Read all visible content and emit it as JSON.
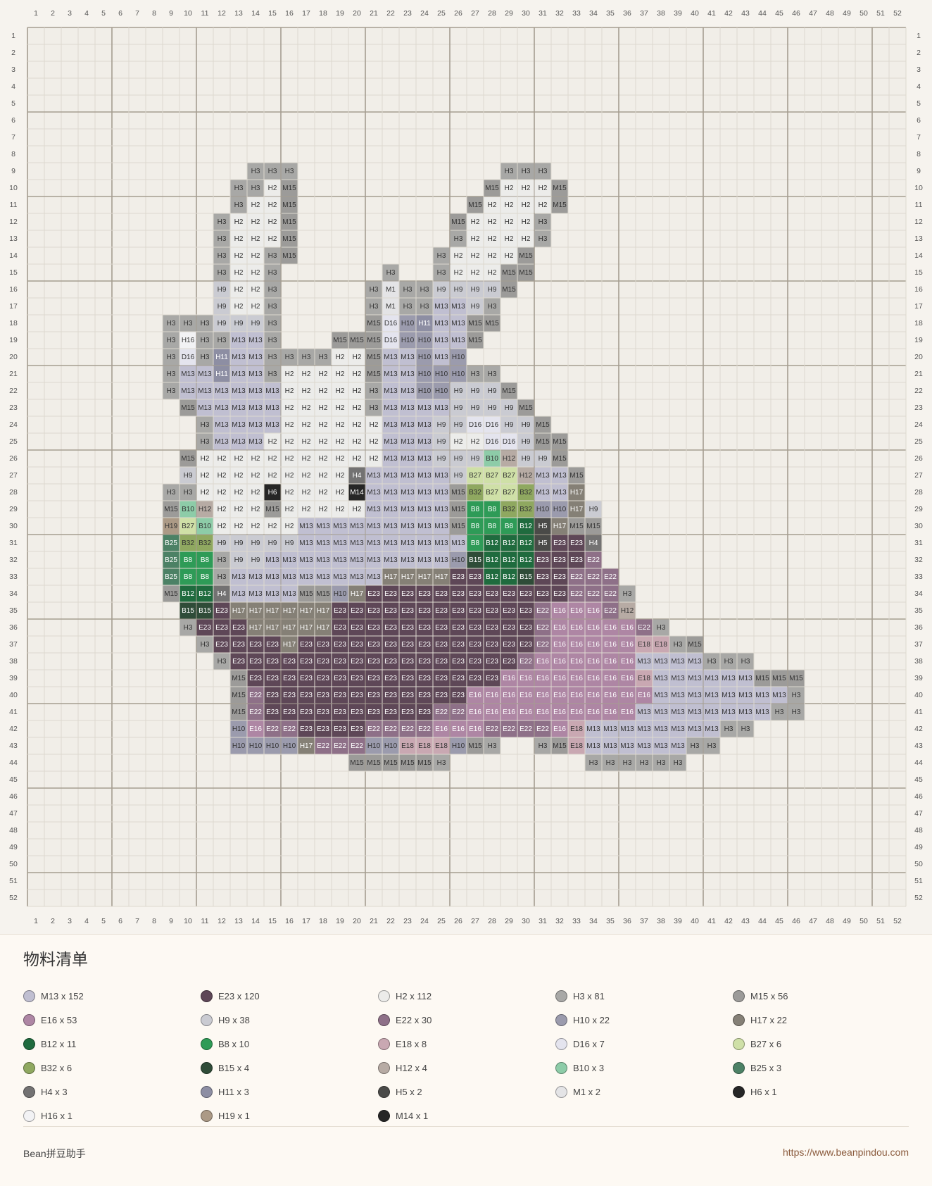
{
  "axis": {
    "count": 52
  },
  "palette": {
    "H2": "#ececea",
    "H3": "#a8a8a6",
    "M15": "#9c9b99",
    "H9": "#cacbd2",
    "M1": "#e4e4e6",
    "M13": "#c0bfd1",
    "D16": "#e4e4ee",
    "H10": "#9b9bad",
    "H11": "#8d8ea3",
    "H16": "#f2f2f4",
    "H12": "#b7aba4",
    "B10": "#8dcca8",
    "B27": "#cfe0a7",
    "B32": "#8fa860",
    "H4": "#737272",
    "H6": "#262626",
    "M14": "#262626",
    "B8": "#2e9b57",
    "B12": "#1f6b3e",
    "H5": "#4a4a48",
    "H17": "#858076",
    "H19": "#ac9a86",
    "B25": "#4c8165",
    "B15": "#2f4c38",
    "E23": "#5e4757",
    "E22": "#8e7088",
    "E16": "#ae86a4",
    "E18": "#c9a8b2"
  },
  "grid_rows": [
    {
      "row": 9,
      "start": 14,
      "cells": [
        "H3",
        "H3",
        "H3"
      ]
    },
    {
      "row": 9,
      "start": 29,
      "cells": [
        "H3",
        "H3",
        "H3"
      ]
    },
    {
      "row": 10,
      "start": 13,
      "cells": [
        "H3",
        "H3",
        "H2",
        "M15"
      ]
    },
    {
      "row": 10,
      "start": 28,
      "cells": [
        "M15",
        "H2",
        "H2",
        "H2",
        "M15"
      ]
    },
    {
      "row": 11,
      "start": 13,
      "cells": [
        "H3",
        "H2",
        "H2",
        "M15"
      ]
    },
    {
      "row": 11,
      "start": 27,
      "cells": [
        "M15",
        "H2",
        "H2",
        "H2",
        "H2",
        "M15"
      ]
    },
    {
      "row": 12,
      "start": 12,
      "cells": [
        "H3",
        "H2",
        "H2",
        "H2",
        "M15"
      ]
    },
    {
      "row": 12,
      "start": 26,
      "cells": [
        "M15",
        "H2",
        "H2",
        "H2",
        "H2",
        "H3"
      ]
    },
    {
      "row": 13,
      "start": 12,
      "cells": [
        "H3",
        "H2",
        "H2",
        "H2",
        "M15"
      ]
    },
    {
      "row": 13,
      "start": 26,
      "cells": [
        "H3",
        "H2",
        "H2",
        "H2",
        "H2",
        "H3"
      ]
    },
    {
      "row": 14,
      "start": 12,
      "cells": [
        "H3",
        "H2",
        "H2",
        "H3",
        "M15"
      ]
    },
    {
      "row": 14,
      "start": 25,
      "cells": [
        "H3",
        "H2",
        "H2",
        "H2",
        "H2",
        "M15"
      ]
    },
    {
      "row": 15,
      "start": 12,
      "cells": [
        "H3",
        "H2",
        "H2",
        "H3"
      ]
    },
    {
      "row": 15,
      "start": 22,
      "cells": [
        "H3"
      ]
    },
    {
      "row": 15,
      "start": 25,
      "cells": [
        "H3",
        "H2",
        "H2",
        "H2",
        "M15",
        "M15"
      ]
    },
    {
      "row": 16,
      "start": 12,
      "cells": [
        "H9",
        "H2",
        "H2",
        "H3"
      ]
    },
    {
      "row": 16,
      "start": 21,
      "cells": [
        "H3",
        "M1",
        "H3",
        "H3",
        "H9",
        "H9",
        "H9",
        "H9",
        "M15"
      ]
    },
    {
      "row": 17,
      "start": 12,
      "cells": [
        "H9",
        "H2",
        "H2",
        "H3"
      ]
    },
    {
      "row": 17,
      "start": 21,
      "cells": [
        "H3",
        "M1",
        "H3",
        "H3",
        "M13",
        "M13",
        "H9",
        "H3"
      ]
    },
    {
      "row": 18,
      "start": 9,
      "cells": [
        "H3",
        "H3",
        "H3",
        "H9",
        "H9",
        "H9",
        "H3"
      ]
    },
    {
      "row": 18,
      "start": 21,
      "cells": [
        "M15",
        "D16",
        "H10",
        "H11",
        "M13",
        "M13",
        "M15",
        "M15"
      ]
    },
    {
      "row": 19,
      "start": 9,
      "cells": [
        "H3",
        "H16",
        "H3",
        "H3",
        "M13",
        "M13",
        "H3"
      ]
    },
    {
      "row": 19,
      "start": 19,
      "cells": [
        "M15",
        "M15",
        "M15",
        "D16",
        "H10",
        "H10",
        "M13",
        "M13",
        "M15"
      ]
    },
    {
      "row": 20,
      "start": 9,
      "cells": [
        "H3",
        "D16",
        "H3",
        "H11",
        "M13",
        "M13",
        "H3",
        "H3",
        "H3",
        "H3",
        "H2",
        "H2",
        "M15",
        "M13",
        "M13",
        "H10",
        "M13",
        "H10"
      ]
    },
    {
      "row": 21,
      "start": 9,
      "cells": [
        "H3",
        "M13",
        "M13",
        "H11",
        "M13",
        "M13",
        "H3",
        "H2",
        "H2",
        "H2",
        "H2",
        "H2",
        "M15",
        "M13",
        "M13",
        "H10",
        "H10",
        "H10",
        "H3",
        "H3"
      ]
    },
    {
      "row": 22,
      "start": 9,
      "cells": [
        "H3",
        "M13",
        "M13",
        "M13",
        "M13",
        "M13",
        "M13",
        "H2",
        "H2",
        "H2",
        "H2",
        "H2",
        "H3",
        "M13",
        "M13",
        "H10",
        "H10",
        "H9",
        "H9",
        "H9",
        "M15"
      ]
    },
    {
      "row": 23,
      "start": 10,
      "cells": [
        "M15",
        "M13",
        "M13",
        "M13",
        "M13",
        "M13",
        "H2",
        "H2",
        "H2",
        "H2",
        "H2",
        "H3",
        "M13",
        "M13",
        "M13",
        "M13",
        "H9",
        "H9",
        "H9",
        "H9",
        "M15"
      ]
    },
    {
      "row": 24,
      "start": 11,
      "cells": [
        "H3",
        "M13",
        "M13",
        "M13",
        "M13",
        "H2",
        "H2",
        "H2",
        "H2",
        "H2",
        "H2",
        "M13",
        "M13",
        "M13",
        "H9",
        "H9",
        "D16",
        "D16",
        "H9",
        "H9",
        "M15"
      ]
    },
    {
      "row": 25,
      "start": 11,
      "cells": [
        "H3",
        "M13",
        "M13",
        "M13",
        "H2",
        "H2",
        "H2",
        "H2",
        "H2",
        "H2",
        "H2",
        "M13",
        "M13",
        "M13",
        "H9",
        "H2",
        "H2",
        "D16",
        "D16",
        "H9",
        "M15",
        "M15"
      ]
    },
    {
      "row": 26,
      "start": 10,
      "cells": [
        "M15",
        "H2",
        "H2",
        "H2",
        "H2",
        "H2",
        "H2",
        "H2",
        "H2",
        "H2",
        "H2",
        "H2",
        "M13",
        "M13",
        "M13",
        "H9",
        "H9",
        "H9",
        "B10",
        "H12",
        "H9",
        "H9",
        "M15"
      ]
    },
    {
      "row": 27,
      "start": 10,
      "cells": [
        "H9",
        "H2",
        "H2",
        "H2",
        "H2",
        "H2",
        "H2",
        "H2",
        "H2",
        "H2",
        "H4",
        "M13",
        "M13",
        "M13",
        "M13",
        "M13",
        "H9",
        "B27",
        "B27",
        "B27",
        "H12",
        "M13",
        "M13",
        "M15"
      ]
    },
    {
      "row": 28,
      "start": 9,
      "cells": [
        "H3",
        "H3",
        "H2",
        "H2",
        "H2",
        "H2",
        "H6",
        "H2",
        "H2",
        "H2",
        "H2",
        "M14",
        "M13",
        "M13",
        "M13",
        "M13",
        "M13",
        "M15",
        "B32",
        "B27",
        "B27",
        "B32",
        "M13",
        "M13",
        "H17"
      ]
    },
    {
      "row": 29,
      "start": 9,
      "cells": [
        "M15",
        "B10",
        "H12",
        "H2",
        "H2",
        "H2",
        "M15",
        "H2",
        "H2",
        "H2",
        "H2",
        "H2",
        "M13",
        "M13",
        "M13",
        "M13",
        "M13",
        "M15",
        "B8",
        "B8",
        "B32",
        "B32",
        "H10",
        "H10",
        "H17",
        "H9"
      ]
    },
    {
      "row": 30,
      "start": 9,
      "cells": [
        "H19",
        "B27",
        "B10",
        "H2",
        "H2",
        "H2",
        "H2",
        "H2",
        "M13",
        "M13",
        "M13",
        "M13",
        "M13",
        "M13",
        "M13",
        "M13",
        "M13",
        "M15",
        "B8",
        "B8",
        "B8",
        "B12",
        "H5",
        "H17",
        "M15",
        "M15"
      ]
    },
    {
      "row": 31,
      "start": 9,
      "cells": [
        "B25",
        "B32",
        "B32",
        "H9",
        "H9",
        "H9",
        "H9",
        "H9",
        "M13",
        "M13",
        "M13",
        "M13",
        "M13",
        "M13",
        "M13",
        "M13",
        "M13",
        "M13",
        "B8",
        "B12",
        "B12",
        "B12",
        "H5",
        "E23",
        "E23",
        "H4"
      ]
    },
    {
      "row": 32,
      "start": 9,
      "cells": [
        "B25",
        "B8",
        "B8",
        "H3",
        "H9",
        "H9",
        "M13",
        "M13",
        "M13",
        "M13",
        "M13",
        "M13",
        "M13",
        "M13",
        "M13",
        "M13",
        "M13",
        "H10",
        "B15",
        "B12",
        "B12",
        "B12",
        "E23",
        "E23",
        "E23",
        "E22"
      ]
    },
    {
      "row": 33,
      "start": 9,
      "cells": [
        "B25",
        "B8",
        "B8",
        "H3",
        "M13",
        "M13",
        "M13",
        "M13",
        "M13",
        "M13",
        "M13",
        "M13",
        "M13",
        "H17",
        "H17",
        "H17",
        "H17",
        "E23",
        "E23",
        "B12",
        "B12",
        "B15",
        "E23",
        "E23",
        "E22",
        "E22",
        "E22"
      ]
    },
    {
      "row": 34,
      "start": 9,
      "cells": [
        "M15",
        "B12",
        "B12",
        "H4",
        "M13",
        "M13",
        "M13",
        "M13",
        "M15",
        "M15",
        "H10",
        "H17",
        "E23",
        "E23",
        "E23",
        "E23",
        "E23",
        "E23",
        "E23",
        "E23",
        "E23",
        "E23",
        "E23",
        "E23",
        "E22",
        "E22",
        "E22",
        "H3"
      ]
    },
    {
      "row": 35,
      "start": 10,
      "cells": [
        "B15",
        "B15",
        "E23",
        "H17",
        "H17",
        "H17",
        "H17",
        "H17",
        "H17",
        "E23",
        "E23",
        "E23",
        "E23",
        "E23",
        "E23",
        "E23",
        "E23",
        "E23",
        "E23",
        "E23",
        "E23",
        "E22",
        "E16",
        "E16",
        "E16",
        "E22",
        "H12"
      ]
    },
    {
      "row": 36,
      "start": 10,
      "cells": [
        "H3",
        "E23",
        "E23",
        "E23",
        "H17",
        "H17",
        "H17",
        "H17",
        "H17",
        "E23",
        "E23",
        "E23",
        "E23",
        "E23",
        "E23",
        "E23",
        "E23",
        "E23",
        "E23",
        "E23",
        "E23",
        "E22",
        "E16",
        "E16",
        "E16",
        "E16",
        "E16",
        "E22",
        "H3"
      ]
    },
    {
      "row": 37,
      "start": 11,
      "cells": [
        "H3",
        "E23",
        "E23",
        "E23",
        "E23",
        "H17",
        "E23",
        "E23",
        "E23",
        "E23",
        "E23",
        "E23",
        "E23",
        "E23",
        "E23",
        "E23",
        "E23",
        "E23",
        "E23",
        "E23",
        "E22",
        "E16",
        "E16",
        "E16",
        "E16",
        "E16",
        "E18",
        "E18",
        "H3",
        "M15"
      ]
    },
    {
      "row": 38,
      "start": 12,
      "cells": [
        "H3",
        "E23",
        "E23",
        "E23",
        "E23",
        "E23",
        "E23",
        "E23",
        "E23",
        "E23",
        "E23",
        "E23",
        "E23",
        "E23",
        "E23",
        "E23",
        "E23",
        "E23",
        "E22",
        "E16",
        "E16",
        "E16",
        "E16",
        "E16",
        "E16",
        "M13",
        "M13",
        "M13",
        "M13",
        "H3",
        "H3",
        "H3"
      ]
    },
    {
      "row": 39,
      "start": 13,
      "cells": [
        "M15",
        "E23",
        "E23",
        "E23",
        "E23",
        "E23",
        "E23",
        "E23",
        "E23",
        "E23",
        "E23",
        "E23",
        "E23",
        "E23",
        "E23",
        "E23",
        "E16",
        "E16",
        "E16",
        "E16",
        "E16",
        "E16",
        "E16",
        "E16",
        "E18",
        "M13",
        "M13",
        "M13",
        "M13",
        "M13",
        "M13",
        "M15",
        "M15",
        "M15"
      ]
    },
    {
      "row": 40,
      "start": 13,
      "cells": [
        "M15",
        "E22",
        "E23",
        "E23",
        "E23",
        "E23",
        "E23",
        "E23",
        "E23",
        "E23",
        "E23",
        "E23",
        "E23",
        "E23",
        "E16",
        "E16",
        "E16",
        "E16",
        "E16",
        "E16",
        "E16",
        "E16",
        "E16",
        "E16",
        "E16",
        "M13",
        "M13",
        "M13",
        "M13",
        "M13",
        "M13",
        "M13",
        "M13",
        "H3"
      ]
    },
    {
      "row": 41,
      "start": 13,
      "cells": [
        "M15",
        "E22",
        "E23",
        "E23",
        "E23",
        "E23",
        "E23",
        "E23",
        "E23",
        "E23",
        "E23",
        "E23",
        "E22",
        "E22",
        "E16",
        "E16",
        "E16",
        "E16",
        "E16",
        "E16",
        "E16",
        "E16",
        "E16",
        "E16",
        "M13",
        "M13",
        "M13",
        "M13",
        "M13",
        "M13",
        "M13",
        "M13",
        "H3",
        "H3"
      ]
    },
    {
      "row": 42,
      "start": 13,
      "cells": [
        "H10",
        "E16",
        "E22",
        "E22",
        "E23",
        "E23",
        "E23",
        "E23",
        "E22",
        "E22",
        "E22",
        "E22",
        "E16",
        "E16",
        "E16",
        "E22",
        "E22",
        "E22",
        "E22",
        "E16",
        "E18",
        "M13",
        "M13",
        "M13",
        "M13",
        "M13",
        "M13",
        "M13",
        "M13",
        "H3",
        "H3"
      ]
    },
    {
      "row": 43,
      "start": 13,
      "cells": [
        "H10",
        "H10",
        "H10",
        "H10",
        "H17",
        "E22",
        "E22",
        "E22",
        "H10",
        "H10",
        "E18",
        "E18",
        "E18",
        "H10",
        "M15",
        "H3"
      ]
    },
    {
      "row": 43,
      "start": 31,
      "cells": [
        "H3",
        "M15",
        "E18",
        "M13",
        "M13",
        "M13",
        "M13",
        "M13",
        "M13",
        "H3",
        "H3"
      ]
    },
    {
      "row": 44,
      "start": 20,
      "cells": [
        "M15",
        "M15",
        "M15",
        "M15",
        "M15",
        "H3"
      ]
    },
    {
      "row": 44,
      "start": 34,
      "cells": [
        "H3",
        "H3",
        "H3",
        "H3",
        "H3",
        "H3"
      ]
    }
  ],
  "materials_title": "物料清单",
  "materials": [
    {
      "code": "M13",
      "label": "M13 x 152",
      "color": "#c0bfd1"
    },
    {
      "code": "E23",
      "label": "E23 x 120",
      "color": "#5e4757"
    },
    {
      "code": "H2",
      "label": "H2 x 112",
      "color": "#ececea"
    },
    {
      "code": "H3",
      "label": "H3 x 81",
      "color": "#a8a8a6"
    },
    {
      "code": "M15",
      "label": "M15 x 56",
      "color": "#9c9b99"
    },
    {
      "code": "E16",
      "label": "E16 x 53",
      "color": "#ae86a4"
    },
    {
      "code": "H9",
      "label": "H9 x 38",
      "color": "#cacbd2"
    },
    {
      "code": "E22",
      "label": "E22 x 30",
      "color": "#8e7088"
    },
    {
      "code": "H10",
      "label": "H10 x 22",
      "color": "#9b9bad"
    },
    {
      "code": "H17",
      "label": "H17 x 22",
      "color": "#858076"
    },
    {
      "code": "B12",
      "label": "B12 x 11",
      "color": "#1f6b3e"
    },
    {
      "code": "B8",
      "label": "B8 x 10",
      "color": "#2e9b57"
    },
    {
      "code": "E18",
      "label": "E18 x 8",
      "color": "#c9a8b2"
    },
    {
      "code": "D16",
      "label": "D16 x 7",
      "color": "#e4e4ee"
    },
    {
      "code": "B27",
      "label": "B27 x 6",
      "color": "#cfe0a7"
    },
    {
      "code": "B32",
      "label": "B32 x 6",
      "color": "#8fa860"
    },
    {
      "code": "B15",
      "label": "B15 x 4",
      "color": "#2f4c38"
    },
    {
      "code": "H12",
      "label": "H12 x 4",
      "color": "#b7aba4"
    },
    {
      "code": "B10",
      "label": "B10 x 3",
      "color": "#8dcca8"
    },
    {
      "code": "B25",
      "label": "B25 x 3",
      "color": "#4c8165"
    },
    {
      "code": "H4",
      "label": "H4 x 3",
      "color": "#737272"
    },
    {
      "code": "H11",
      "label": "H11 x 3",
      "color": "#8d8ea3"
    },
    {
      "code": "H5",
      "label": "H5 x 2",
      "color": "#4a4a48"
    },
    {
      "code": "M1",
      "label": "M1 x 2",
      "color": "#e4e4e6"
    },
    {
      "code": "H6",
      "label": "H6 x 1",
      "color": "#262626"
    },
    {
      "code": "H16",
      "label": "H16 x 1",
      "color": "#f2f2f4"
    },
    {
      "code": "H19",
      "label": "H19 x 1",
      "color": "#ac9a86"
    },
    {
      "code": "M14",
      "label": "M14 x 1",
      "color": "#262626"
    }
  ],
  "footer": {
    "brand": "Bean拼豆助手",
    "url": "https://www.beanpindou.com"
  }
}
